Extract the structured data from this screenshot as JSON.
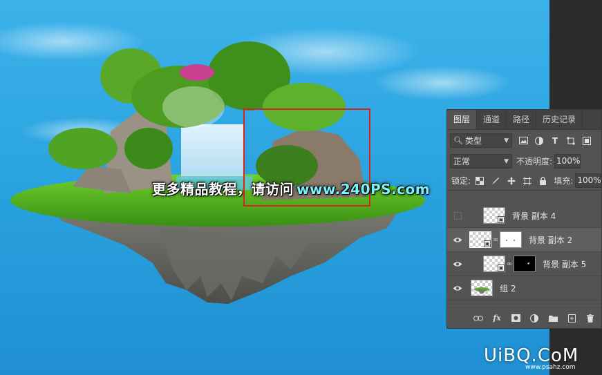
{
  "canvas": {
    "promo_text": "更多精品教程，请访问",
    "promo_url": "www.240PS.com",
    "watermark": "UiBQ.CoM",
    "watermark_sub": "www.psahz.com"
  },
  "panel": {
    "tabs": [
      {
        "label": "图层",
        "active": true
      },
      {
        "label": "通道",
        "active": false
      },
      {
        "label": "路径",
        "active": false
      },
      {
        "label": "历史记录",
        "active": false
      }
    ],
    "filter": {
      "label": "类型",
      "icons": [
        "image-filter-icon",
        "adjustment-filter-icon",
        "type-filter-icon",
        "shape-filter-icon",
        "smart-object-filter-icon"
      ]
    },
    "blend_mode": "正常",
    "opacity_label": "不透明度:",
    "opacity_value": "100%",
    "lock_label": "锁定:",
    "fill_label": "填充:",
    "fill_value": "100%",
    "layers": [
      {
        "name": "背景 副本 4",
        "visible": false,
        "has_mask": false
      },
      {
        "name": "背景 副本 2",
        "visible": true,
        "has_mask": true,
        "selected": true
      },
      {
        "name": "背景 副本 5",
        "visible": true,
        "has_mask": true
      },
      {
        "name": "组 2",
        "visible": true,
        "has_mask": false
      }
    ],
    "bottom_icons": [
      "link-layers-icon",
      "fx-icon",
      "add-mask-icon",
      "adjustment-layer-icon",
      "new-group-icon",
      "new-layer-icon",
      "delete-icon"
    ]
  },
  "colors": {
    "panel_bg": "#535353",
    "selection_red": "#d8241c",
    "sky_blue": "#2ba4e0"
  }
}
